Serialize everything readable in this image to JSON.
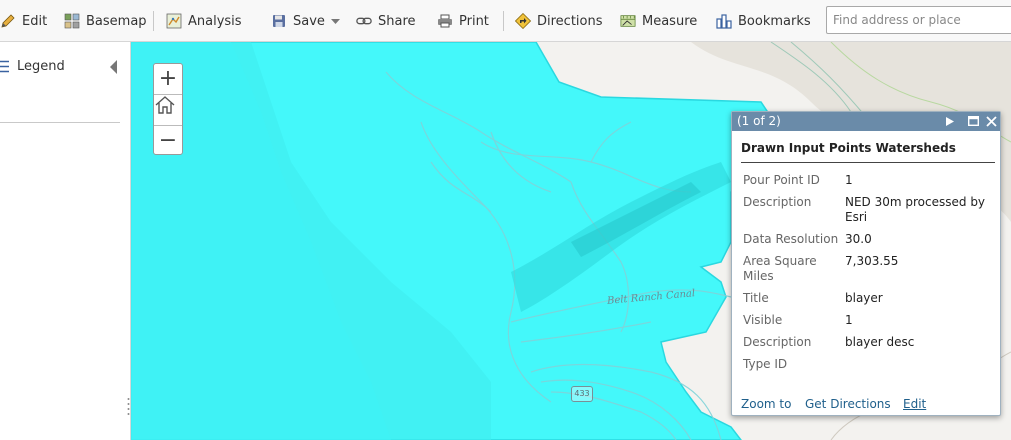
{
  "toolbar": {
    "edit": "Edit",
    "basemap": "Basemap",
    "analysis": "Analysis",
    "save": "Save",
    "share": "Share",
    "print": "Print",
    "directions": "Directions",
    "measure": "Measure",
    "bookmarks": "Bookmarks",
    "search_placeholder": "Find address or place"
  },
  "left_panel": {
    "legend": "Legend"
  },
  "map": {
    "canal_label": "Belt Ranch Canal",
    "route_shield": "433",
    "zoom_in": "+",
    "zoom_out": "−",
    "watershed_fill": "#44f8fa"
  },
  "popup": {
    "count": "(1 of 2)",
    "title": "Drawn Input Points Watersheds",
    "fields": [
      {
        "key": "Pour Point ID",
        "value": "1"
      },
      {
        "key": "Description",
        "value": "NED 30m processed by Esri"
      },
      {
        "key": "Data Resolution",
        "value": "30.0"
      },
      {
        "key": "Area Square Miles",
        "value": "7,303.55"
      },
      {
        "key": "Title",
        "value": "blayer"
      },
      {
        "key": "Visible",
        "value": "1"
      },
      {
        "key": "Description",
        "value": "blayer desc"
      },
      {
        "key": "Type ID",
        "value": ""
      }
    ],
    "links": {
      "zoom_to": "Zoom to",
      "get_directions": "Get Directions",
      "edit": "Edit"
    },
    "header_color": "#6a8ba9",
    "link_color": "#1f5f8b"
  }
}
